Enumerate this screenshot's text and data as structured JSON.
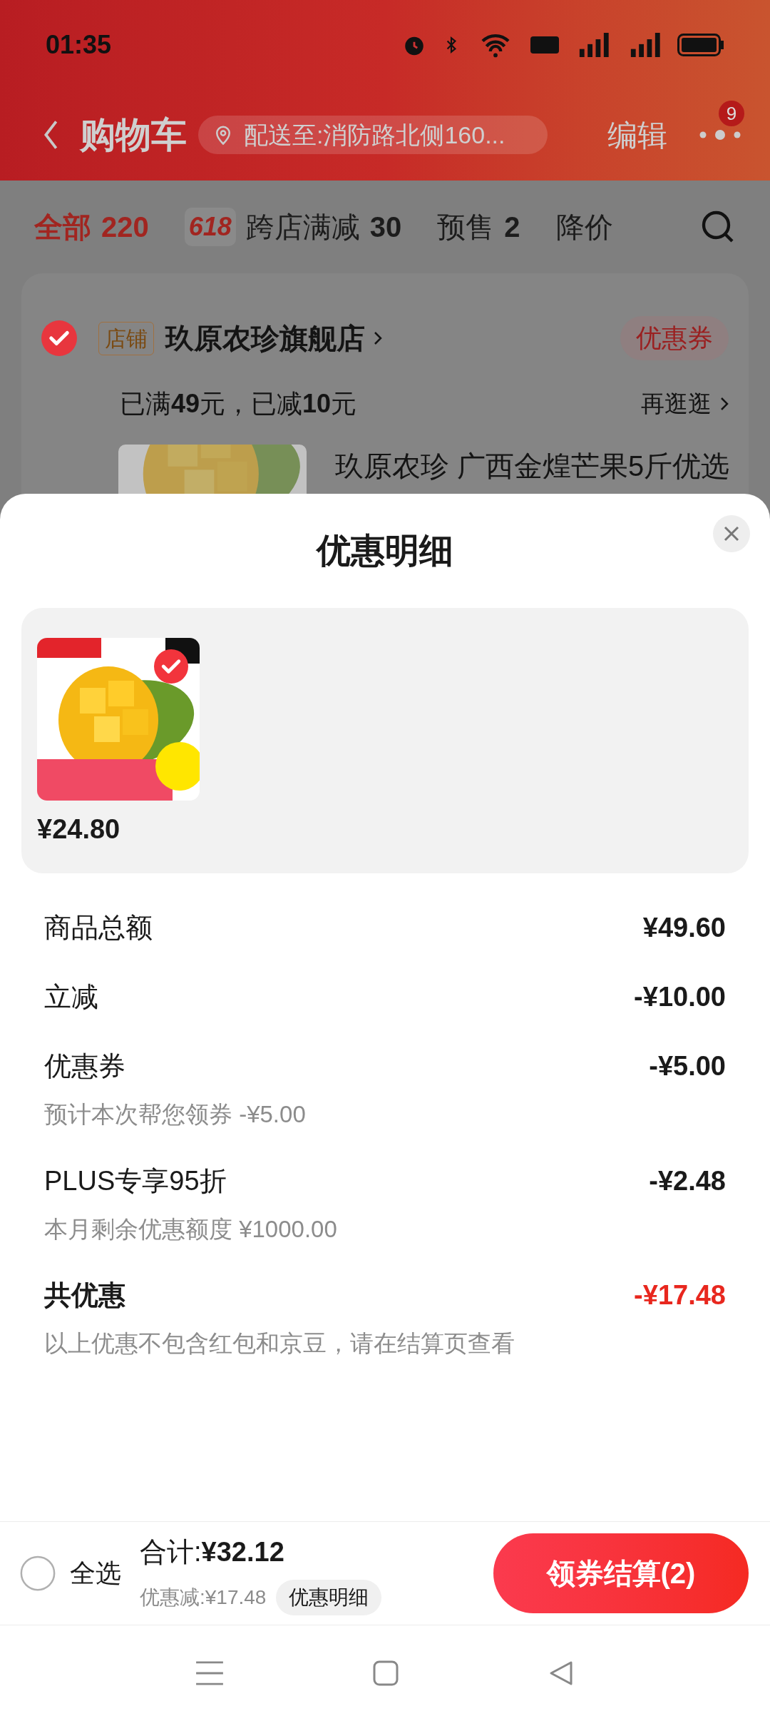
{
  "status_bar": {
    "time": "01:35"
  },
  "header": {
    "title": "购物车",
    "address": "配送至:消防路北侧160...",
    "edit": "编辑",
    "badge": "9"
  },
  "filter_tabs": [
    {
      "label": "全部",
      "count": "220",
      "selected": true
    },
    {
      "badge": "618",
      "label": "跨店满减",
      "count": "30",
      "selected": false
    },
    {
      "label": "预售",
      "count": "2",
      "selected": false
    },
    {
      "label": "降价",
      "selected": false
    }
  ],
  "store": {
    "checked": true,
    "tag": "店铺",
    "name": "玖原农珍旗舰店",
    "coupon": "优惠券",
    "promo": "已满**49**元，已减**10**元",
    "more": "再逛逛",
    "product_title": "玖原农珍 广西金煌芒果5斤优选"
  },
  "sheet": {
    "title": "优惠明细",
    "product": {
      "selected": true,
      "price": "¥24.80"
    },
    "rows": [
      {
        "kind": "item",
        "label": "商品总额",
        "value": "¥49.60"
      },
      {
        "kind": "item",
        "label": "立减",
        "value": "-¥10.00"
      },
      {
        "kind": "item",
        "label": "优惠券",
        "value": "-¥5.00",
        "note": "预计本次帮您领券 -¥5.00"
      },
      {
        "kind": "item",
        "label": "PLUS专享95折",
        "value": "-¥2.48",
        "note": "本月剩余优惠额度 ¥1000.00"
      },
      {
        "kind": "total",
        "label": "共优惠",
        "value": "-¥17.48",
        "note": "以上优惠不包含红包和京豆，请在结算页查看"
      }
    ]
  },
  "bottom_bar": {
    "select_all": {
      "label": "全选",
      "checked": false
    },
    "total": "合计:**¥32.12**",
    "discount": "优惠减:¥17.48",
    "detail_button": "优惠明细",
    "checkout": "领券结算(2)"
  }
}
